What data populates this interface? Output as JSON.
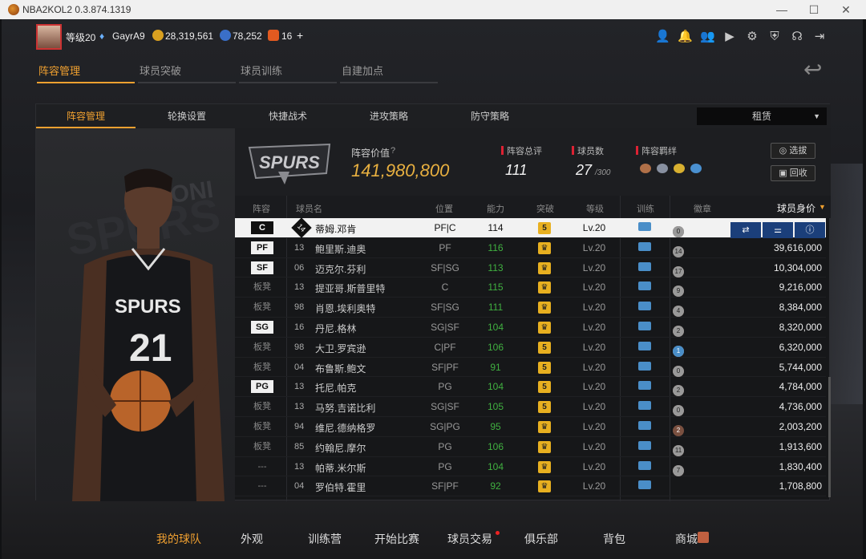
{
  "window": {
    "title": "NBA2KOL2 0.3.874.1319",
    "minimize": "—",
    "maximize": "☐",
    "close": "✕"
  },
  "profile": {
    "level": "等级20",
    "username": "GayrA9",
    "coins": "28,319,561",
    "points": "78,252",
    "d_currency": "16",
    "add": "+"
  },
  "top_icons": [
    "person-icon",
    "bell-icon",
    "friends-icon",
    "video-icon",
    "gear-icon",
    "shield-icon",
    "headset-icon",
    "exit-icon"
  ],
  "nav1": [
    "阵容管理",
    "球员突破",
    "球员训练",
    "自建加点"
  ],
  "nav1_active": 0,
  "tabs2": [
    "阵容管理",
    "轮换设置",
    "快捷战术",
    "进攻策略",
    "防守策略"
  ],
  "rent": {
    "label": "租赁",
    "caret": "▼"
  },
  "team": {
    "logo_text": "SPURS"
  },
  "summary": {
    "value_label": "阵容价值",
    "value": "141,980,800",
    "overall_label": "阵容总评",
    "overall": "111",
    "count_label": "球员数",
    "count": "27",
    "count_max": "/300",
    "bond_label": "阵容羁绊",
    "select_btn": "选拔",
    "recycle_btn": "回收"
  },
  "table_headers": {
    "lineup": "阵容",
    "name": "球员名",
    "position": "位置",
    "rating": "能力",
    "breakthrough": "突破",
    "level": "等级",
    "training": "训练",
    "badges": "徽章",
    "value": "球员身价"
  },
  "rows": [
    {
      "pos": "C",
      "num": "14",
      "name": "蒂姆.邓肯",
      "ppos": "PF|C",
      "rating": "114",
      "brk": "5",
      "lvl": "Lv.20",
      "badges": [
        [
          "14",
          "br"
        ],
        [
          "4",
          "si"
        ],
        [
          "0",
          "si"
        ]
      ],
      "value": "",
      "selected": true
    },
    {
      "pos": "PF",
      "num": "13",
      "name": "鲍里斯.迪奥",
      "ppos": "PF",
      "rating": "116",
      "brk": "crown",
      "lvl": "Lv.20",
      "badges": [
        [
          "3",
          "br"
        ],
        [
          "14",
          "si"
        ]
      ],
      "value": "39,616,000"
    },
    {
      "pos": "SF",
      "num": "06",
      "name": "迈克尔.芬利",
      "ppos": "SF|SG",
      "rating": "113",
      "brk": "crown",
      "lvl": "Lv.20",
      "badges": [
        [
          "2",
          "br"
        ],
        [
          "17",
          "si"
        ]
      ],
      "value": "10,304,000"
    },
    {
      "pos": "板凳",
      "num": "13",
      "name": "提亚哥.斯普里特",
      "ppos": "C",
      "rating": "115",
      "brk": "crown",
      "lvl": "Lv.20",
      "badges": [
        [
          "0",
          "br"
        ],
        [
          "9",
          "si"
        ]
      ],
      "value": "9,216,000"
    },
    {
      "pos": "板凳",
      "num": "98",
      "name": "肖恩.埃利奥特",
      "ppos": "SF|SG",
      "rating": "111",
      "brk": "crown",
      "lvl": "Lv.20",
      "badges": [
        [
          "2",
          "br"
        ],
        [
          "4",
          "si"
        ]
      ],
      "value": "8,384,000"
    },
    {
      "pos": "SG",
      "num": "16",
      "name": "丹尼.格林",
      "ppos": "SG|SF",
      "rating": "104",
      "brk": "crown",
      "lvl": "Lv.20",
      "badges": [
        [
          "0",
          "br"
        ],
        [
          "2",
          "si"
        ]
      ],
      "value": "8,320,000"
    },
    {
      "pos": "板凳",
      "num": "98",
      "name": "大卫.罗宾逊",
      "ppos": "C|PF",
      "rating": "106",
      "brk": "5",
      "lvl": "Lv.20",
      "badges": [
        [
          "15",
          "br"
        ],
        [
          "2",
          "si"
        ],
        [
          "1",
          "bl"
        ]
      ],
      "value": "6,320,000"
    },
    {
      "pos": "板凳",
      "num": "04",
      "name": "布鲁斯.鲍文",
      "ppos": "SF|PF",
      "rating": "91",
      "brk": "5",
      "lvl": "Lv.20",
      "badges": [
        [
          "8",
          "br"
        ],
        [
          "0",
          "si"
        ]
      ],
      "value": "5,744,000"
    },
    {
      "pos": "PG",
      "num": "13",
      "name": "托尼.帕克",
      "ppos": "PG",
      "rating": "104",
      "brk": "5",
      "lvl": "Lv.20",
      "badges": [
        [
          "12",
          "br"
        ],
        [
          "2",
          "si"
        ]
      ],
      "value": "4,784,000"
    },
    {
      "pos": "板凳",
      "num": "13",
      "name": "马努.吉诺比利",
      "ppos": "SG|SF",
      "rating": "105",
      "brk": "5",
      "lvl": "Lv.20",
      "badges": [
        [
          "3",
          "br"
        ],
        [
          "0",
          "si"
        ]
      ],
      "value": "4,736,000"
    },
    {
      "pos": "板凳",
      "num": "94",
      "name": "维尼.德纳格罗",
      "ppos": "SG|PG",
      "rating": "95",
      "brk": "crown",
      "lvl": "Lv.20",
      "badges": [
        [
          "2",
          "br"
        ]
      ],
      "value": "2,003,200"
    },
    {
      "pos": "板凳",
      "num": "85",
      "name": "约翰尼.摩尔",
      "ppos": "PG",
      "rating": "106",
      "brk": "crown",
      "lvl": "Lv.20",
      "badges": [
        [
          "5",
          "br"
        ],
        [
          "11",
          "si"
        ]
      ],
      "value": "1,913,600"
    },
    {
      "pos": "---",
      "num": "13",
      "name": "帕蒂.米尔斯",
      "ppos": "PG",
      "rating": "104",
      "brk": "crown",
      "lvl": "Lv.20",
      "badges": [
        [
          "12",
          "br"
        ],
        [
          "7",
          "si"
        ]
      ],
      "value": "1,830,400"
    },
    {
      "pos": "---",
      "num": "04",
      "name": "罗伯特.霍里",
      "ppos": "SF|PF",
      "rating": "92",
      "brk": "crown",
      "lvl": "Lv.20",
      "badges": [],
      "value": "1,708,800"
    }
  ],
  "bottom_nav": [
    "我的球队",
    "外观",
    "训练营",
    "开始比赛",
    "球员交易",
    "俱乐部",
    "背包",
    "商城"
  ],
  "bottom_active": 0
}
